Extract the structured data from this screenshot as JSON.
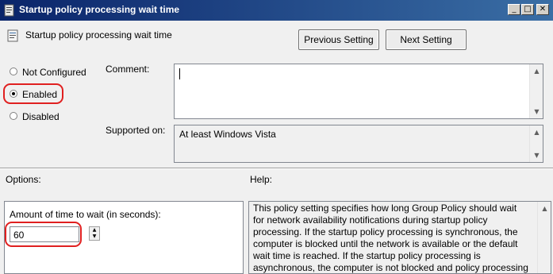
{
  "window": {
    "title": "Startup policy processing wait time"
  },
  "header": {
    "policy_title": "Startup policy processing wait time",
    "prev_label": "Previous Setting",
    "next_label": "Next Setting"
  },
  "state": {
    "options": [
      {
        "label": "Not Configured",
        "checked": false
      },
      {
        "label": "Enabled",
        "checked": true
      },
      {
        "label": "Disabled",
        "checked": false
      }
    ]
  },
  "comment": {
    "label": "Comment:",
    "value": ""
  },
  "supported": {
    "label": "Supported on:",
    "value": "At least Windows Vista"
  },
  "options_section": {
    "heading": "Options:",
    "wait_label": "Amount of time to wait (in seconds):",
    "wait_value": "60"
  },
  "help": {
    "heading": "Help:",
    "lines": [
      "This policy setting specifies how long Group Policy should wait",
      "for network availability notifications during startup policy",
      "processing. If the startup policy processing is synchronous, the",
      "computer is blocked until the network is available or the default",
      "wait time is reached. If the startup policy processing is",
      "asynchronous, the computer is not blocked and policy processing"
    ]
  },
  "colors": {
    "highlight": "#e02020",
    "titlebar": "#0a246a"
  },
  "icons": [
    "policy-icon",
    "minimize-icon",
    "maximize-icon",
    "close-icon",
    "spin-up-icon",
    "spin-down-icon",
    "scroll-up-icon",
    "scroll-down-icon"
  ]
}
